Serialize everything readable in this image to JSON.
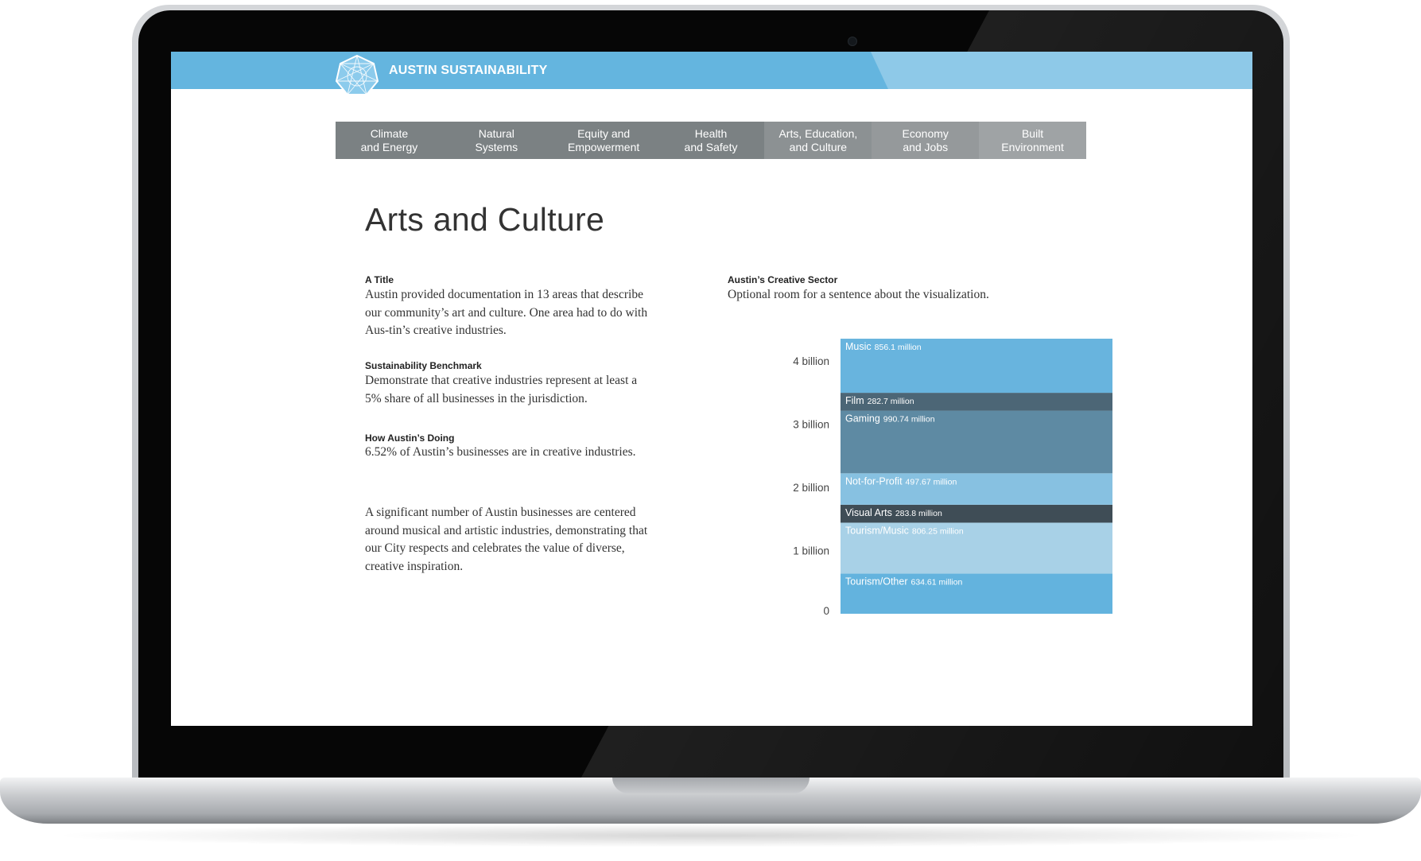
{
  "brand": {
    "name": "AUSTIN SUSTAINABILITY"
  },
  "nav": {
    "items": [
      {
        "label": "Climate\nand Energy"
      },
      {
        "label": "Natural\nSystems"
      },
      {
        "label": "Equity and\nEmpowerment"
      },
      {
        "label": "Health\nand Safety"
      },
      {
        "label": "Arts, Education,\nand Culture"
      },
      {
        "label": "Economy\nand Jobs"
      },
      {
        "label": "Built\nEnvironment"
      }
    ]
  },
  "page": {
    "title": "Arts and Culture"
  },
  "sections": [
    {
      "label": "A Title",
      "text": "Austin provided documentation in 13 areas that describe our community’s art and culture.  One area had to do with Aus-tin’s creative industries."
    },
    {
      "label": "Sustainability Benchmark",
      "text": "Demonstrate that creative industries represent at least a 5% share of all businesses in the jurisdiction."
    },
    {
      "label": "How Austin’s Doing",
      "text": "6.52% of Austin’s businesses are in creative industries."
    },
    {
      "label": "",
      "text": "A significant number of Austin businesses are centered around musical and artistic industries, demonstrating that our City respects and celebrates the value of diverse, creative inspiration."
    }
  ],
  "viz": {
    "label": "Austin’s Creative Sector",
    "caption": "Optional room for a sentence about the visualization."
  },
  "chart_data": {
    "type": "bar",
    "stacked": true,
    "y_ticks": [
      {
        "value": 0,
        "label": "0"
      },
      {
        "value": 1000,
        "label": "1 billion"
      },
      {
        "value": 2000,
        "label": "2 billion"
      },
      {
        "value": 3000,
        "label": "3 billion"
      },
      {
        "value": 4000,
        "label": "4 billion"
      }
    ],
    "unit": "million",
    "series": [
      {
        "name": "Tourism/Other",
        "value": 634.61,
        "value_label": "634.61 million",
        "color": "#63b3de"
      },
      {
        "name": "Tourism/Music",
        "value": 806.25,
        "value_label": "806.25 million",
        "color": "#a8d1e7"
      },
      {
        "name": "Visual Arts",
        "value": 283.8,
        "value_label": "283.8 million",
        "color": "#3f4d56"
      },
      {
        "name": "Not-for-Profit",
        "value": 497.67,
        "value_label": "497.67 million",
        "color": "#87c1e1"
      },
      {
        "name": "Gaming",
        "value": 990.74,
        "value_label": "990.74 million",
        "color": "#5e8aa3"
      },
      {
        "name": "Film",
        "value": 282.7,
        "value_label": "282.7 million",
        "color": "#4c6676"
      },
      {
        "name": "Music",
        "value": 856.1,
        "value_label": "856.1 million",
        "color": "#68b4de"
      }
    ]
  }
}
